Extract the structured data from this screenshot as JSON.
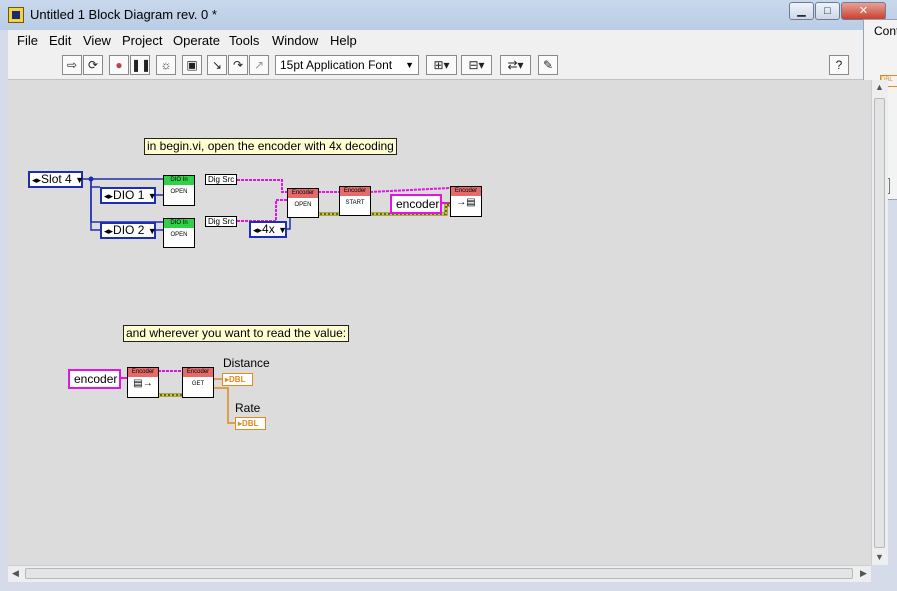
{
  "window": {
    "title": "Untitled 1 Block Diagram rev. 0 *"
  },
  "menu": [
    "File",
    "Edit",
    "View",
    "Project",
    "Operate",
    "Tools",
    "Window",
    "Help"
  ],
  "toolbar": {
    "font": "15pt Application Font"
  },
  "panel": {
    "title": "Cont",
    "badge": "DBL"
  },
  "diagram": {
    "comment1": "in begin.vi, open the encoder with 4x decoding",
    "comment2": "and wherever you want to read the value:",
    "slot": "Slot 4",
    "dio1": "DIO 1",
    "dio2": "DIO 2",
    "decoding": "4x",
    "encoder_ref": "encoder",
    "encoder_ref2": "encoder",
    "dig_src": "Dig Src",
    "dio_in": "DIO In",
    "open": "OPEN",
    "encoder_hdr": "Encoder",
    "start": "START",
    "get": "GET",
    "distance": "Distance",
    "rate": "Rate",
    "dbl": "DBL"
  }
}
